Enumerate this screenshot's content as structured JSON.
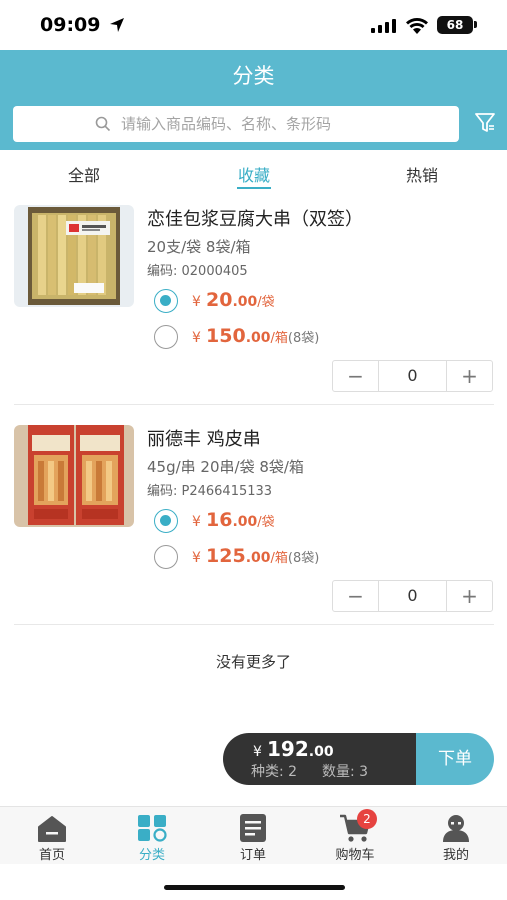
{
  "status_bar": {
    "time": "09:09",
    "battery": "68"
  },
  "header": {
    "title": "分类"
  },
  "search": {
    "placeholder": "请输入商品编码、名称、条形码"
  },
  "tabs": [
    {
      "label": "全部",
      "active": false
    },
    {
      "label": "收藏",
      "active": true
    },
    {
      "label": "热销",
      "active": false
    }
  ],
  "products": [
    {
      "name": "恋佳包浆豆腐大串（双签）",
      "spec": "20支/袋 8袋/箱",
      "code": "编码: 02000405",
      "prices": [
        {
          "yen": "¥",
          "integer": "20",
          "decimal": ".00",
          "unit": "/袋",
          "extra": "",
          "selected": true
        },
        {
          "yen": "¥",
          "integer": "150",
          "decimal": ".00",
          "unit": "/箱",
          "extra": "(8袋)",
          "selected": false
        }
      ],
      "quantity": "0",
      "image": "tofu-skewer-package"
    },
    {
      "name": "丽德丰 鸡皮串",
      "spec": "45g/串 20串/袋 8袋/箱",
      "code": "编码: P2466415133",
      "prices": [
        {
          "yen": "¥",
          "integer": "16",
          "decimal": ".00",
          "unit": "/袋",
          "extra": "",
          "selected": true
        },
        {
          "yen": "¥",
          "integer": "125",
          "decimal": ".00",
          "unit": "/箱",
          "extra": "(8袋)",
          "selected": false
        }
      ],
      "quantity": "0",
      "image": "chicken-skin-skewer-package"
    }
  ],
  "stepper": {
    "minus": "−",
    "plus": "+"
  },
  "list_footer": "没有更多了",
  "cart": {
    "yen": "¥",
    "total_integer": "192",
    "total_decimal": ".00",
    "kinds_label": "种类: 2",
    "qty_label": "数量: 3",
    "order_label": "下单"
  },
  "bottom_nav": [
    {
      "label": "首页",
      "icon": "home-icon",
      "active": false
    },
    {
      "label": "分类",
      "icon": "category-icon",
      "active": true
    },
    {
      "label": "订单",
      "icon": "order-icon",
      "active": false
    },
    {
      "label": "购物车",
      "icon": "cart-icon",
      "active": false,
      "badge": "2"
    },
    {
      "label": "我的",
      "icon": "profile-icon",
      "active": false
    }
  ],
  "colors": {
    "accent": "#5bb9cf",
    "price": "#e2653d",
    "cart_bar": "#333333",
    "badge": "#e64340"
  }
}
